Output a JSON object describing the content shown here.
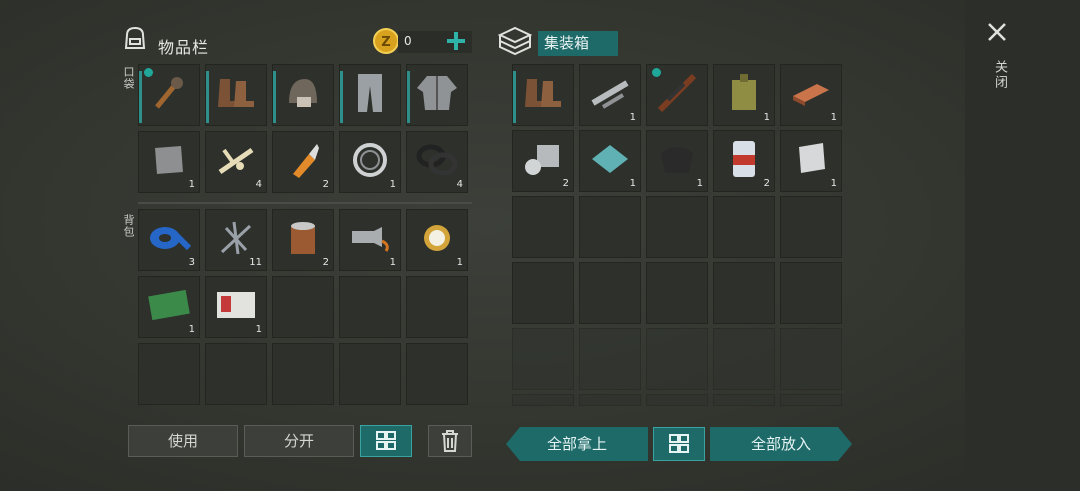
{
  "inventory": {
    "title": "物品栏",
    "coins": "0",
    "pocket_label": "口袋",
    "backpack_label": "背包",
    "pocket": [
      {
        "icon": "club-icon",
        "count": "",
        "equipped": true,
        "locked": true
      },
      {
        "icon": "boots-icon",
        "count": "",
        "equipped": true
      },
      {
        "icon": "hat-icon",
        "count": "",
        "equipped": true
      },
      {
        "icon": "pants-icon",
        "count": "",
        "equipped": true
      },
      {
        "icon": "jacket-icon",
        "count": "",
        "equipped": true
      },
      {
        "icon": "scrap-metal-icon",
        "count": "1"
      },
      {
        "icon": "bones-icon",
        "count": "4"
      },
      {
        "icon": "glue-icon",
        "count": "2"
      },
      {
        "icon": "bearing-icon",
        "count": "1"
      },
      {
        "icon": "gaskets-icon",
        "count": "4"
      }
    ],
    "backpack": [
      {
        "icon": "tape-icon",
        "count": "3"
      },
      {
        "icon": "nails-icon",
        "count": "11"
      },
      {
        "icon": "tin-can-icon",
        "count": "2"
      },
      {
        "icon": "flashlight-icon",
        "count": "1"
      },
      {
        "icon": "watch-icon",
        "count": "1"
      },
      {
        "icon": "coupon-icon",
        "count": "1"
      },
      {
        "icon": "army-card-icon",
        "count": "1"
      },
      {
        "icon": "",
        "count": ""
      },
      {
        "icon": "",
        "count": ""
      },
      {
        "icon": "",
        "count": ""
      },
      {
        "icon": "",
        "count": ""
      },
      {
        "icon": "",
        "count": ""
      },
      {
        "icon": "",
        "count": ""
      },
      {
        "icon": "",
        "count": ""
      },
      {
        "icon": "",
        "count": ""
      }
    ]
  },
  "container": {
    "title": "集装箱",
    "items": [
      {
        "icon": "boots-icon",
        "count": "",
        "equipped": true
      },
      {
        "icon": "pipe-icon",
        "count": "1"
      },
      {
        "icon": "rifle-icon",
        "count": "",
        "locked": true
      },
      {
        "icon": "jerrycan-icon",
        "count": "1"
      },
      {
        "icon": "copper-bar-icon",
        "count": "1"
      },
      {
        "icon": "engine-part-icon",
        "count": "2"
      },
      {
        "icon": "tarp-icon",
        "count": "1"
      },
      {
        "icon": "rubber-mat-icon",
        "count": "1"
      },
      {
        "icon": "beer-can-icon",
        "count": "2"
      },
      {
        "icon": "steel-plate-icon",
        "count": "1"
      }
    ]
  },
  "buttons": {
    "use": "使用",
    "split": "分开",
    "take_all": "全部拿上",
    "put_all": "全部放入",
    "close": "关闭"
  },
  "colors": {
    "accent": "#1e6a69",
    "accent_border": "#3aa3a0",
    "coin": "#d9a21e"
  }
}
